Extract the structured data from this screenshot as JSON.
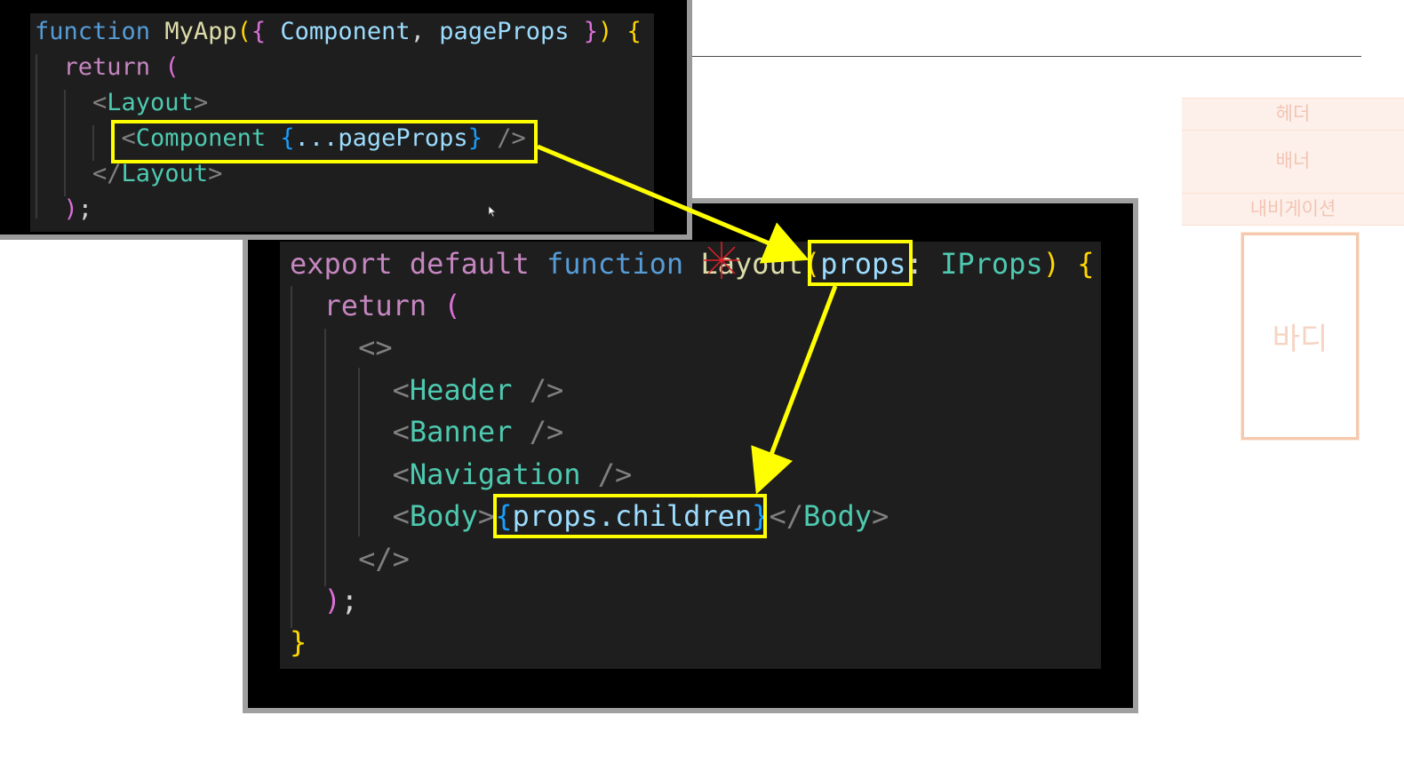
{
  "code_top": {
    "lines": [
      [
        {
          "t": "function ",
          "c": "kw"
        },
        {
          "t": "MyApp",
          "c": "fn"
        },
        {
          "t": "(",
          "c": "br1"
        },
        {
          "t": "{ ",
          "c": "br2"
        },
        {
          "t": "Component",
          "c": "vr"
        },
        {
          "t": ", ",
          "c": "tx"
        },
        {
          "t": "pageProps",
          "c": "vr"
        },
        {
          "t": " }",
          "c": "br2"
        },
        {
          "t": ")",
          "c": "br1"
        },
        {
          "t": " {",
          "c": "br1"
        }
      ],
      [
        {
          "t": "  return ",
          "c": "ret"
        },
        {
          "t": "(",
          "c": "br2"
        }
      ],
      [
        {
          "t": "    <",
          "c": "pu"
        },
        {
          "t": "Layout",
          "c": "tg"
        },
        {
          "t": ">",
          "c": "pu"
        }
      ],
      [
        {
          "t": "      <",
          "c": "pu"
        },
        {
          "t": "Component ",
          "c": "tg"
        },
        {
          "t": "{",
          "c": "br3"
        },
        {
          "t": "...pageProps",
          "c": "vr"
        },
        {
          "t": "}",
          "c": "br3"
        },
        {
          "t": " />",
          "c": "pu"
        }
      ],
      [
        {
          "t": "    </",
          "c": "pu"
        },
        {
          "t": "Layout",
          "c": "tg"
        },
        {
          "t": ">",
          "c": "pu"
        }
      ],
      [
        {
          "t": "  )",
          "c": "br2"
        },
        {
          "t": ";",
          "c": "tx"
        }
      ]
    ]
  },
  "code_main": {
    "lines": [
      [
        {
          "t": "export ",
          "c": "ret"
        },
        {
          "t": "default ",
          "c": "ret"
        },
        {
          "t": "function ",
          "c": "kw"
        },
        {
          "t": "Layout",
          "c": "fn"
        },
        {
          "t": "(",
          "c": "br1"
        },
        {
          "t": "props",
          "c": "vr"
        },
        {
          "t": ": ",
          "c": "tx"
        },
        {
          "t": "IProps",
          "c": "tg"
        },
        {
          "t": ")",
          "c": "br1"
        },
        {
          "t": " {",
          "c": "br1"
        }
      ],
      [
        {
          "t": "  return ",
          "c": "ret"
        },
        {
          "t": "(",
          "c": "br2"
        }
      ],
      [
        {
          "t": "    <>",
          "c": "pu"
        }
      ],
      [
        {
          "t": "      <",
          "c": "pu"
        },
        {
          "t": "Header",
          "c": "tg"
        },
        {
          "t": " />",
          "c": "pu"
        }
      ],
      [
        {
          "t": "      <",
          "c": "pu"
        },
        {
          "t": "Banner",
          "c": "tg"
        },
        {
          "t": " />",
          "c": "pu"
        }
      ],
      [
        {
          "t": "      <",
          "c": "pu"
        },
        {
          "t": "Navigation",
          "c": "tg"
        },
        {
          "t": " />",
          "c": "pu"
        }
      ],
      [
        {
          "t": "      <",
          "c": "pu"
        },
        {
          "t": "Body",
          "c": "tg"
        },
        {
          "t": ">",
          "c": "pu"
        },
        {
          "t": "{",
          "c": "br3"
        },
        {
          "t": "props.children",
          "c": "vr"
        },
        {
          "t": "}",
          "c": "br3"
        },
        {
          "t": "</",
          "c": "pu"
        },
        {
          "t": "Body",
          "c": "tg"
        },
        {
          "t": ">",
          "c": "pu"
        }
      ],
      [
        {
          "t": "    </>",
          "c": "pu"
        }
      ],
      [
        {
          "t": "  )",
          "c": "br2"
        },
        {
          "t": ";",
          "c": "tx"
        }
      ],
      [
        {
          "t": "}",
          "c": "br1"
        }
      ]
    ]
  },
  "wireframe": {
    "header": "헤더",
    "banner": "배너",
    "navigation": "내비게이션",
    "body": "바디"
  },
  "colors": {
    "highlight": "#ffff00",
    "editor_bg": "#1e1e1e",
    "wire_fill": "#fdf0ea",
    "wire_border": "#f5c9ad"
  }
}
